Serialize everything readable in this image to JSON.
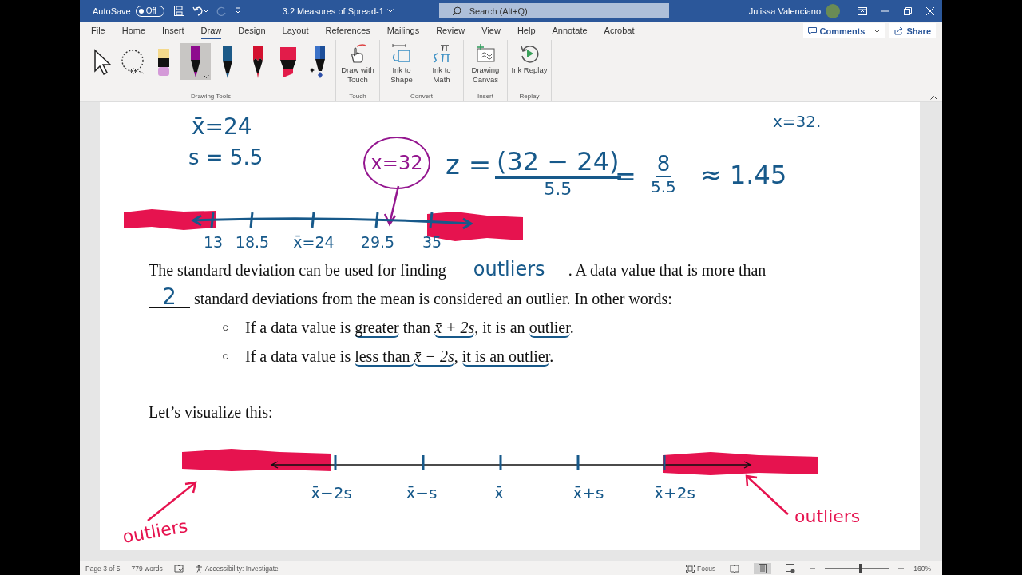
{
  "window": {
    "title": "3.2 Measures of Spread-1",
    "user": "Julissa Valenciano",
    "search_placeholder": "Search (Alt+Q)"
  },
  "autosave": {
    "label": "AutoSave",
    "on": false,
    "state_text": "Off"
  },
  "menu_tabs": [
    {
      "label": "File",
      "selected": false
    },
    {
      "label": "Home",
      "selected": false
    },
    {
      "label": "Insert",
      "selected": false
    },
    {
      "label": "Draw",
      "selected": true
    },
    {
      "label": "Design",
      "selected": false
    },
    {
      "label": "Layout",
      "selected": false
    },
    {
      "label": "References",
      "selected": false
    },
    {
      "label": "Mailings",
      "selected": false
    },
    {
      "label": "Review",
      "selected": false
    },
    {
      "label": "View",
      "selected": false
    },
    {
      "label": "Help",
      "selected": false
    },
    {
      "label": "Annotate",
      "selected": false
    },
    {
      "label": "Acrobat",
      "selected": false
    }
  ],
  "header_buttons": [
    {
      "kind": "comments",
      "label": "Comments"
    },
    {
      "kind": "share",
      "label": "Share"
    }
  ],
  "ribbon_groups": [
    {
      "label": "Drawing Tools",
      "tools": [
        {
          "kind": "select",
          "selected": false
        },
        {
          "kind": "lasso",
          "selected": false
        },
        {
          "kind": "eraser",
          "selected": false
        },
        {
          "kind": "pen",
          "color": "#8e0b8e",
          "selected": true
        },
        {
          "kind": "pen",
          "color": "#1c5a88",
          "selected": false
        },
        {
          "kind": "pencil",
          "color": "#d3112f",
          "selected": false
        },
        {
          "kind": "highlighter",
          "color": "#e21c4a",
          "selected": false
        },
        {
          "kind": "galaxy",
          "color": "#3b72c8",
          "selected": false
        }
      ]
    },
    {
      "label": "Touch",
      "buttons": [
        {
          "kind": "touch",
          "label": "Draw with Touch"
        }
      ]
    },
    {
      "label": "Convert",
      "buttons": [
        {
          "kind": "shape",
          "label": "Ink to Shape"
        },
        {
          "kind": "math",
          "label": "Ink to Math"
        }
      ]
    },
    {
      "label": "Insert",
      "buttons": [
        {
          "kind": "canvas",
          "label": "Drawing Canvas"
        }
      ]
    },
    {
      "label": "Replay",
      "buttons": [
        {
          "kind": "replay",
          "label": "Ink Replay"
        }
      ]
    }
  ],
  "document": {
    "given": [
      "x̄=24",
      "s = 5.5"
    ],
    "callout": "x=32",
    "formula": {
      "lhs": "z =",
      "numerator": "(32 − 24)",
      "denominator": "5.5",
      "equals": "=",
      "numerator_2": "8",
      "denominator_2": "5.5",
      "result": "≈ 1.45"
    },
    "corner_note": "x=32.",
    "number_line_1": {
      "labels": [
        "13",
        "18.5",
        "x̄=24",
        "29.5",
        "35"
      ]
    },
    "paragraph": {
      "before": "The standard deviation can be used for finding",
      "blank_1": "outliers",
      "middle": ". A data value that is more than",
      "blank_2": "2",
      "after": "standard deviations from the mean is considered an outlier. In other words:"
    },
    "bullets": [
      {
        "marker": "○",
        "parts": [
          {
            "text": "If a data value is ",
            "underlined": false
          },
          {
            "text": "greater",
            "underlined": true
          },
          {
            "text": " than ",
            "underlined": false
          },
          {
            "text": "x̄ + 2s",
            "underlined": true,
            "math": true
          },
          {
            "text": ", it is an ",
            "underlined": false
          },
          {
            "text": "outlier",
            "underlined": true
          },
          {
            "text": ".",
            "underlined": false
          }
        ]
      },
      {
        "marker": "○",
        "parts": [
          {
            "text": "If a data value is ",
            "underlined": false
          },
          {
            "text": "less than ",
            "underlined": true
          },
          {
            "text": "x̄ − 2s",
            "underlined": true,
            "math": true
          },
          {
            "text": ", ",
            "underlined": false
          },
          {
            "text": "it is an outlier",
            "underlined": true
          },
          {
            "text": ".",
            "underlined": false
          }
        ]
      }
    ],
    "visualize_label": "Let’s visualize this:",
    "number_line_2": {
      "labels": [
        "x̄−2s",
        "x̄−s",
        "x̄",
        "x̄+s",
        "x̄+2s"
      ],
      "notes": [
        "outliers",
        "outliers"
      ]
    }
  },
  "status_bar": {
    "items": [
      "Page 3 of 5",
      "779 words",
      "Accessibility: Investigate"
    ],
    "focus": "Focus",
    "views": [
      {
        "kind": "read",
        "selected": false
      },
      {
        "kind": "print",
        "selected": true
      },
      {
        "kind": "web",
        "selected": false
      }
    ],
    "zoom": {
      "level": 0.55,
      "reading": "160%"
    }
  }
}
